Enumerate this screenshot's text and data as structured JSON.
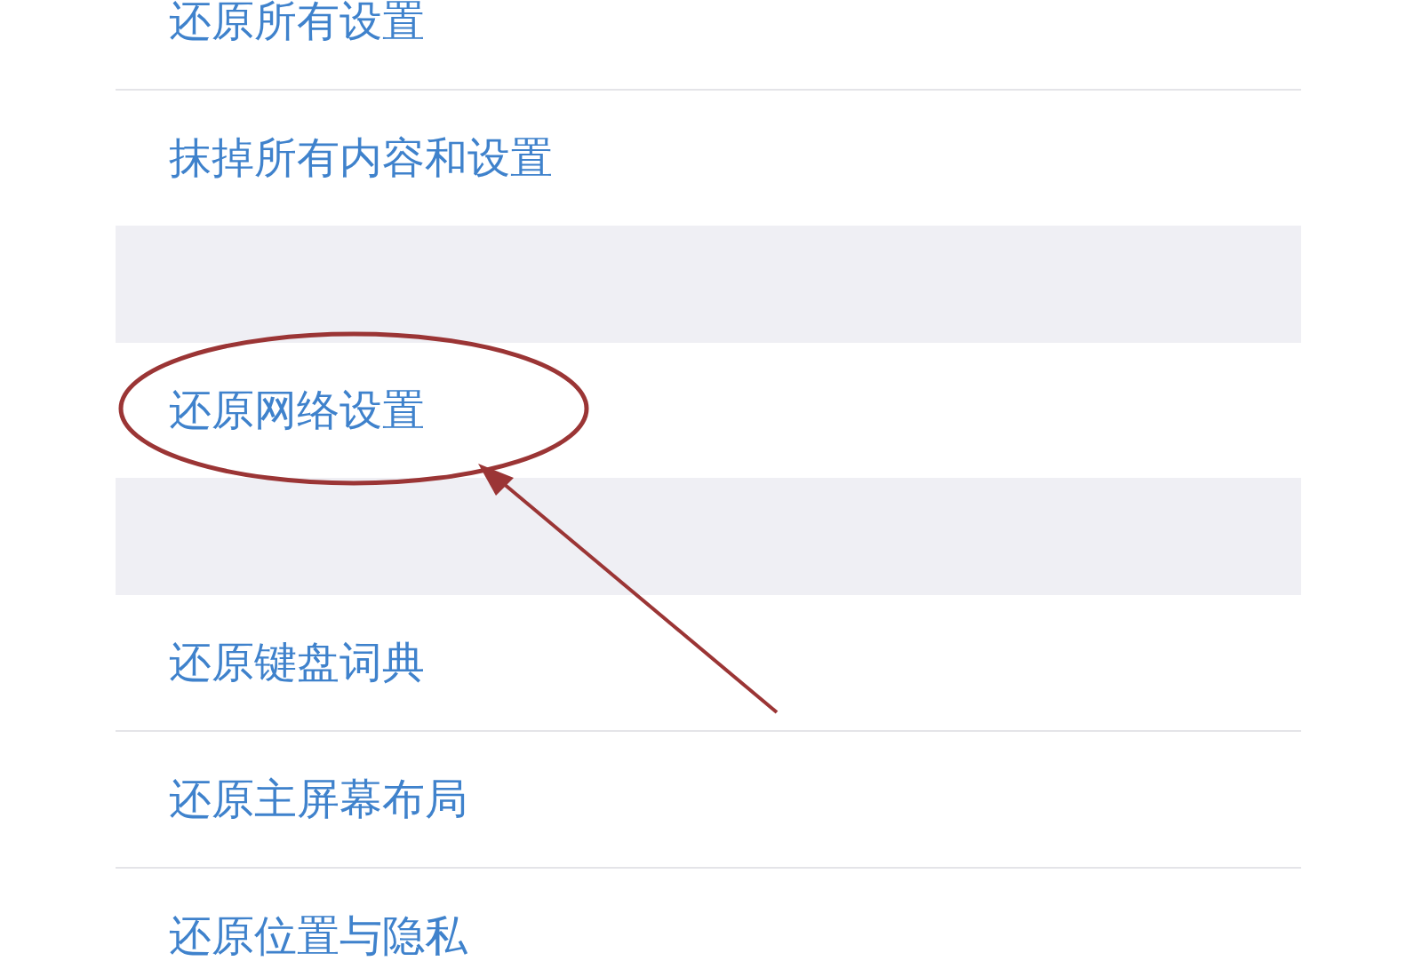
{
  "sections": [
    {
      "rows": [
        {
          "label": "还原所有设置",
          "highlighted": false
        },
        {
          "label": "抹掉所有内容和设置",
          "highlighted": false
        }
      ]
    },
    {
      "rows": [
        {
          "label": "还原网络设置",
          "highlighted": true
        }
      ]
    },
    {
      "rows": [
        {
          "label": "还原键盘词典",
          "highlighted": false
        },
        {
          "label": "还原主屏幕布局",
          "highlighted": false
        },
        {
          "label": "还原位置与隐私",
          "highlighted": false
        }
      ]
    }
  ]
}
